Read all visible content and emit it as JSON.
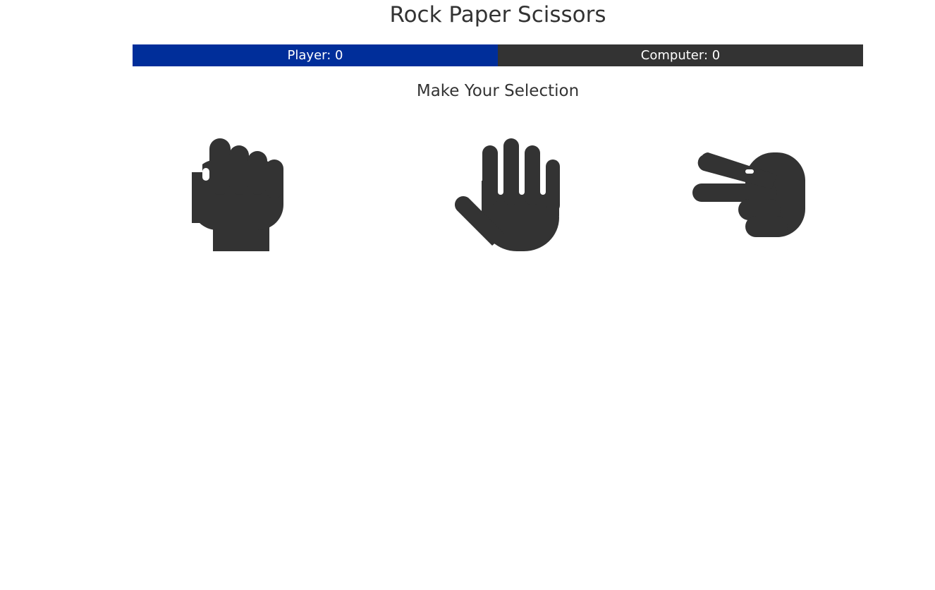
{
  "header": {
    "title": "Rock Paper Scissors"
  },
  "scoreboard": {
    "player_label": "Player: 0",
    "computer_label": "Computer: 0",
    "player_color": "#002e9a",
    "computer_color": "#333333"
  },
  "prompt": {
    "text": "Make Your Selection"
  },
  "choices": [
    {
      "id": "rock",
      "icon": "hand-fist-icon"
    },
    {
      "id": "paper",
      "icon": "hand-open-icon"
    },
    {
      "id": "scissors",
      "icon": "hand-scissors-icon"
    }
  ]
}
